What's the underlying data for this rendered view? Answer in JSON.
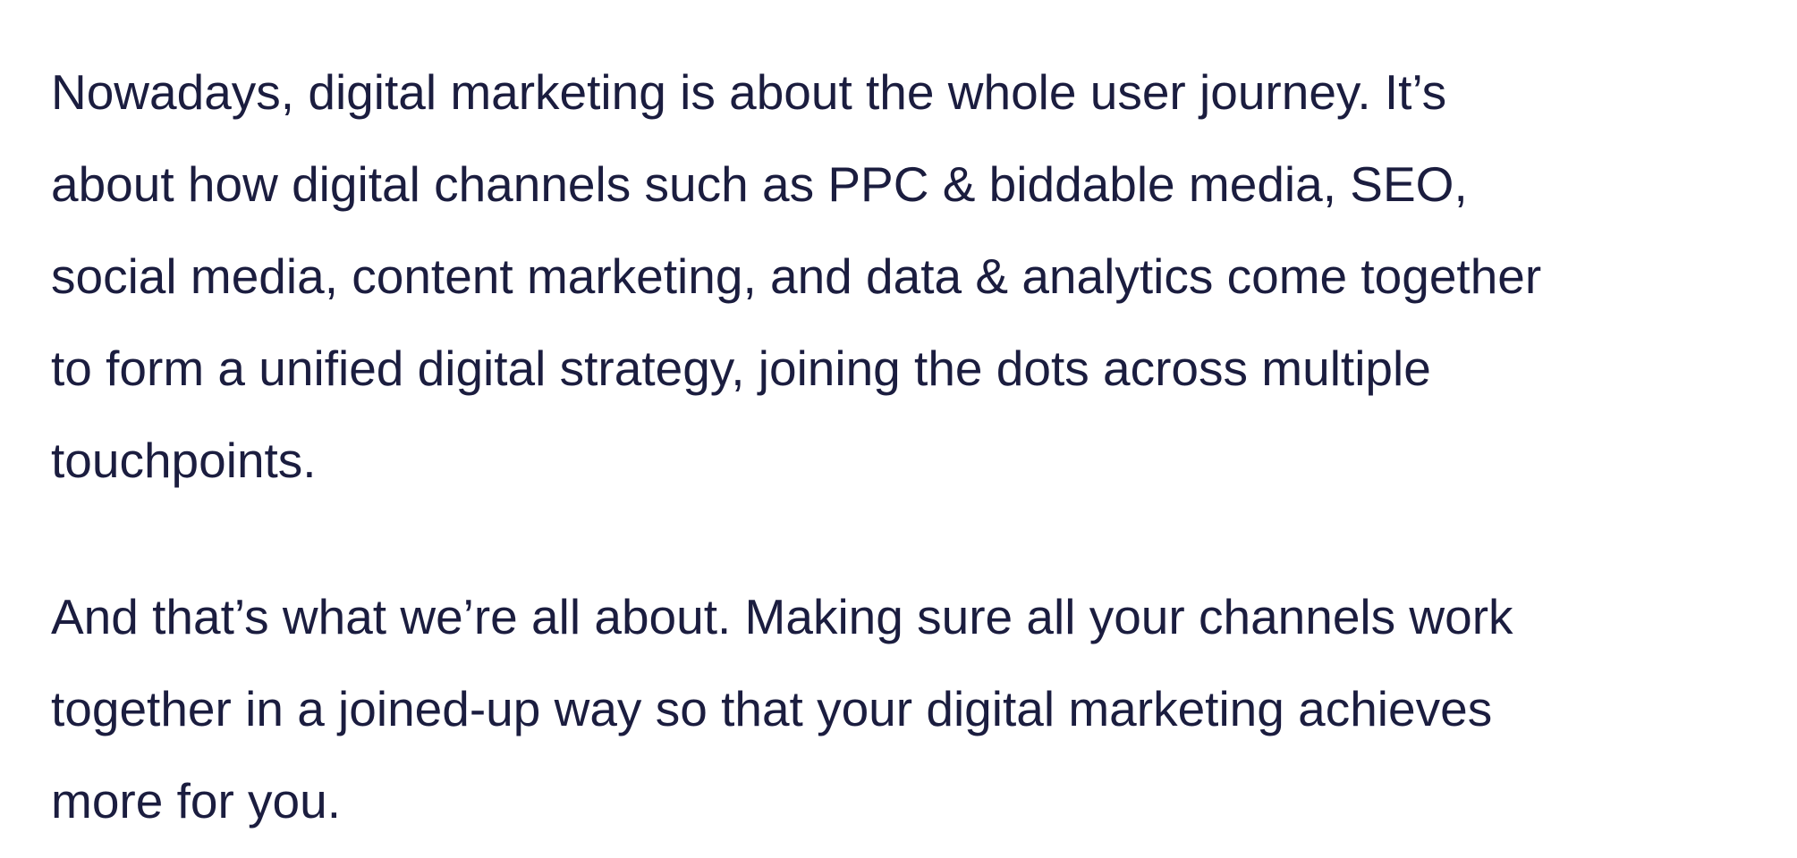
{
  "article": {
    "paragraphs": [
      "Nowadays, digital marketing is about the whole user journey. It’s\nabout how digital channels such as PPC & biddable media, SEO,\nsocial media, content marketing, and data & analytics come together\nto form a unified digital strategy, joining the dots across multiple\ntouchpoints.",
      "And that’s what we’re all about. Making sure all your channels work\ntogether in a joined-up way so that your digital marketing achieves\nmore for you."
    ]
  },
  "colors": {
    "text": "#1b1d3f",
    "background": "#ffffff"
  }
}
